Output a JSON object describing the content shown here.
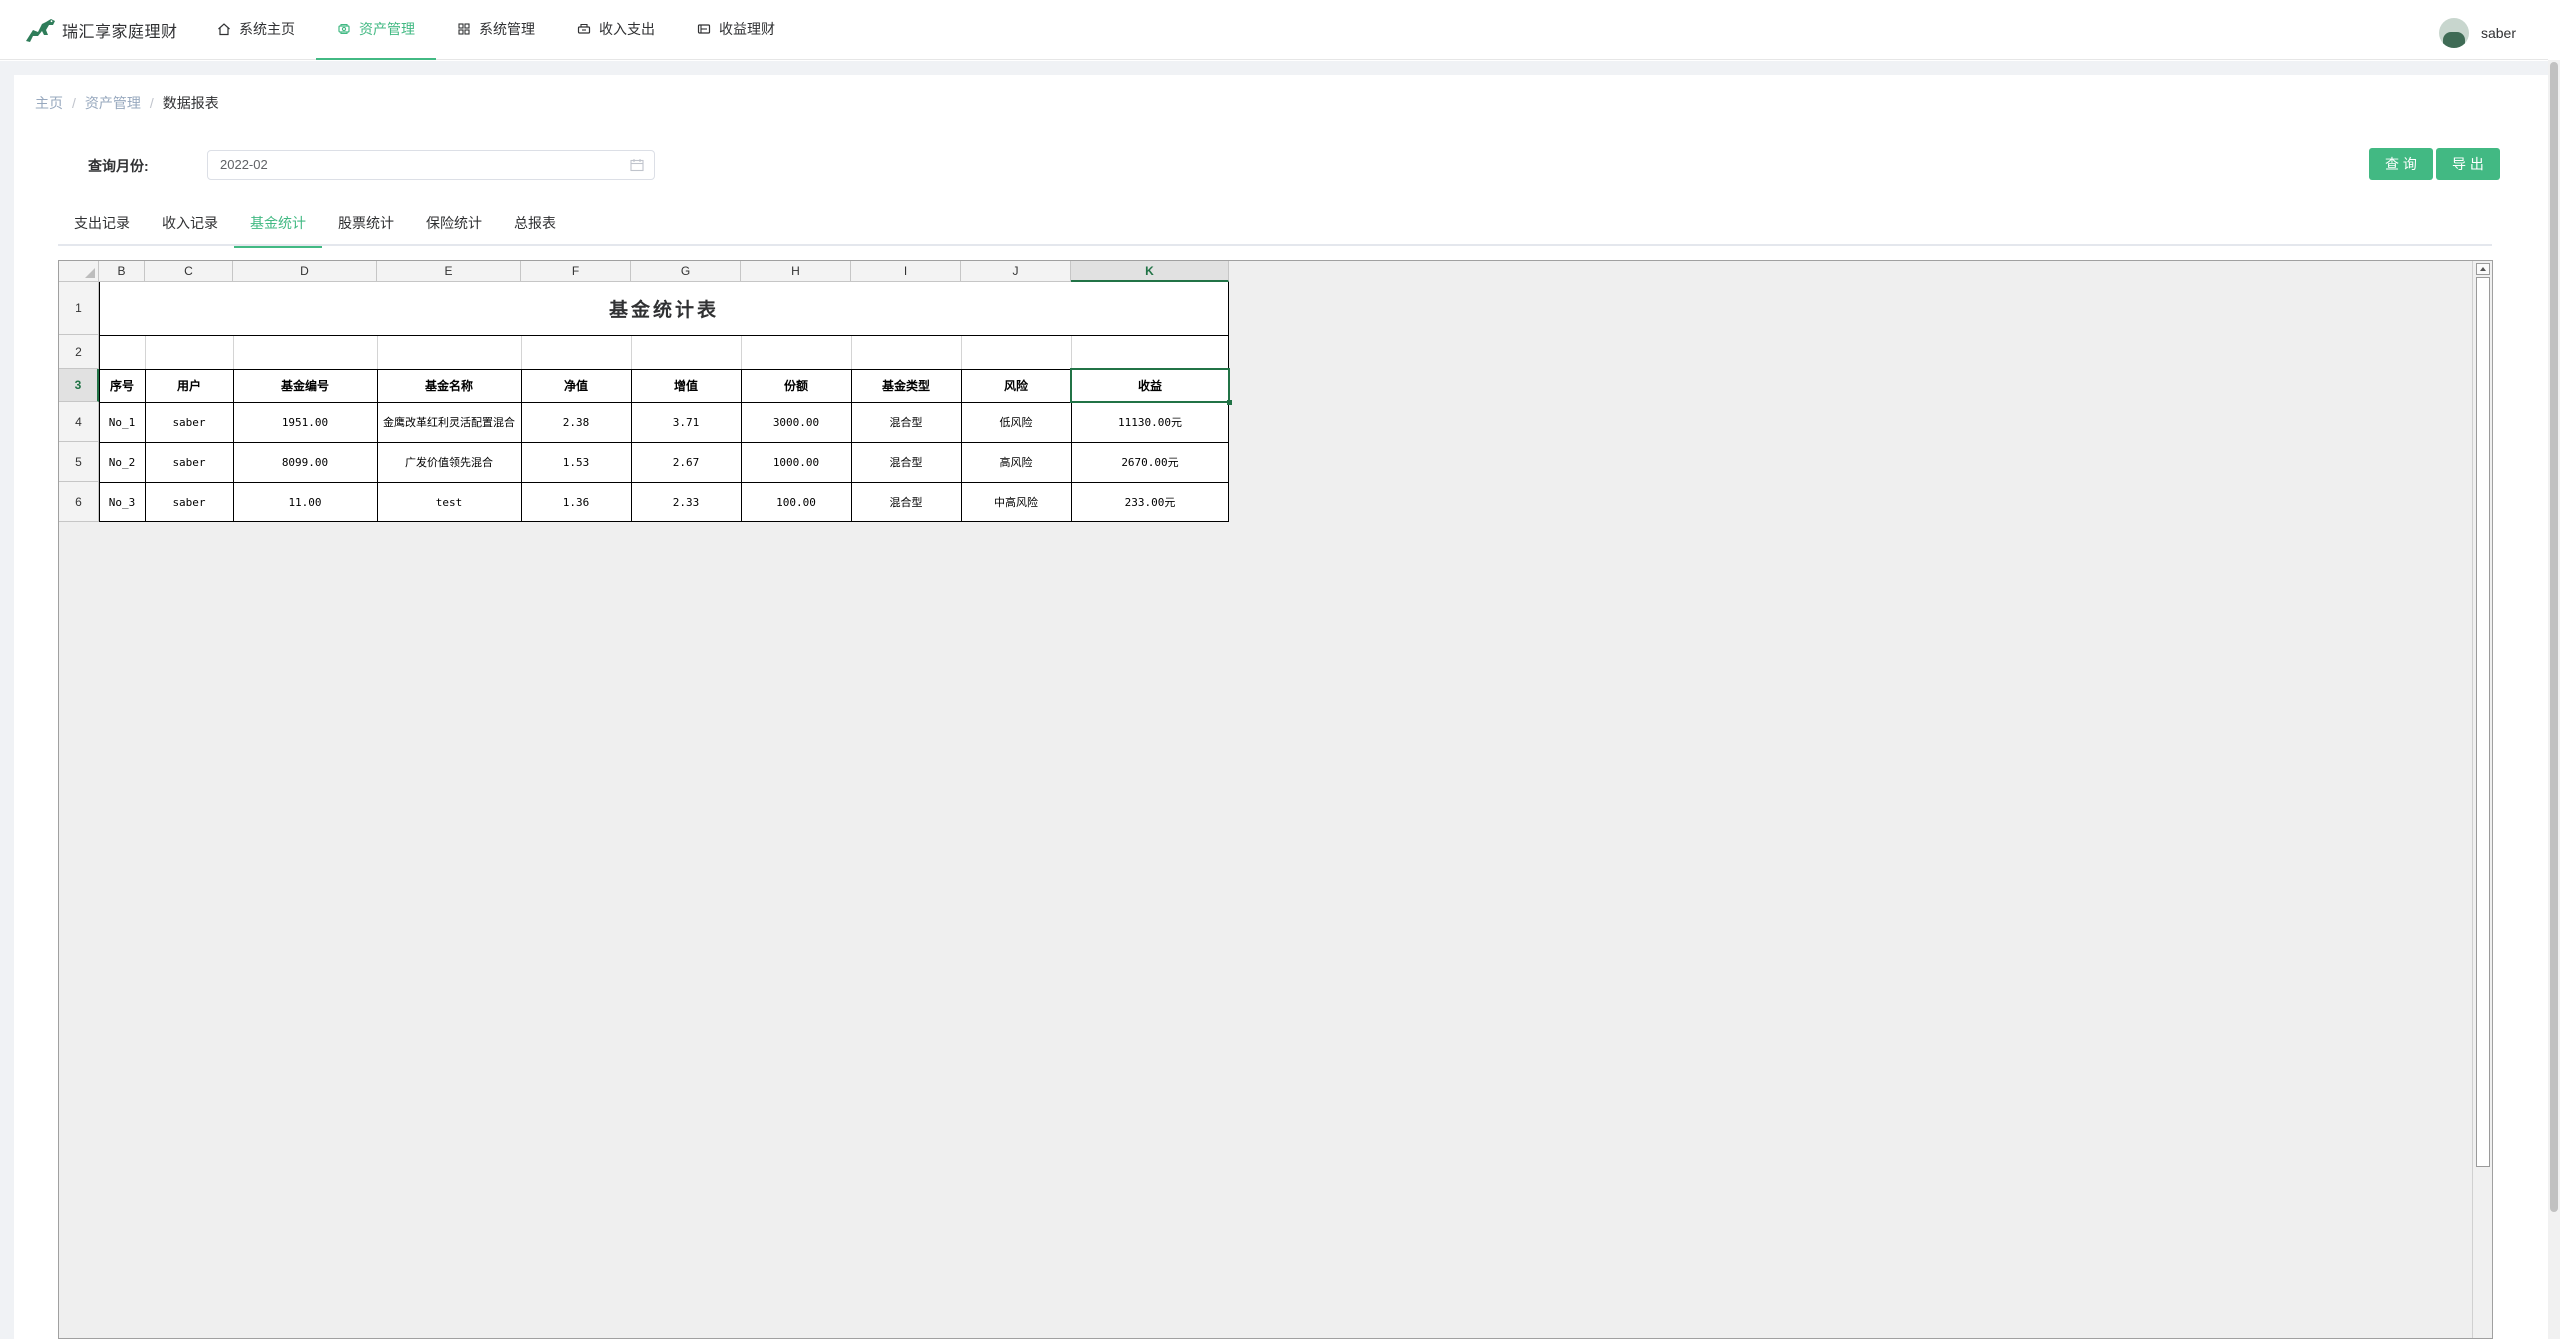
{
  "app": {
    "title": "瑞汇享家庭理财"
  },
  "nav": {
    "items": [
      {
        "label": "系统主页",
        "icon": "home-icon",
        "active": false
      },
      {
        "label": "资产管理",
        "icon": "asset-icon",
        "active": true
      },
      {
        "label": "系统管理",
        "icon": "grid-icon",
        "active": false
      },
      {
        "label": "收入支出",
        "icon": "wallet-icon",
        "active": false
      },
      {
        "label": "收益理财",
        "icon": "finance-icon",
        "active": false
      }
    ]
  },
  "user": {
    "name": "saber"
  },
  "breadcrumb": {
    "items": [
      "主页",
      "资产管理",
      "数据报表"
    ]
  },
  "filter": {
    "label": "查询月份:",
    "month_value": "2022-02"
  },
  "buttons": {
    "query": "查 询",
    "export": "导 出"
  },
  "tabs": [
    {
      "label": "支出记录",
      "active": false
    },
    {
      "label": "收入记录",
      "active": false
    },
    {
      "label": "基金统计",
      "active": true
    },
    {
      "label": "股票统计",
      "active": false
    },
    {
      "label": "保险统计",
      "active": false
    },
    {
      "label": "总报表",
      "active": false
    }
  ],
  "sheet": {
    "columns": [
      "B",
      "C",
      "D",
      "E",
      "F",
      "G",
      "H",
      "I",
      "J",
      "K"
    ],
    "selected_column": "K",
    "rows": [
      "1",
      "2",
      "3",
      "4",
      "5",
      "6"
    ],
    "selected_row": "3",
    "title": "基金统计表",
    "headers": [
      "序号",
      "用户",
      "基金编号",
      "基金名称",
      "净值",
      "增值",
      "份额",
      "基金类型",
      "风险",
      "收益"
    ],
    "data": [
      [
        "No_1",
        "saber",
        "1951.00",
        "金鹰改革红利灵活配置混合",
        "2.38",
        "3.71",
        "3000.00",
        "混合型",
        "低风险",
        "11130.00元"
      ],
      [
        "No_2",
        "saber",
        "8099.00",
        "广发价值领先混合",
        "1.53",
        "2.67",
        "1000.00",
        "混合型",
        "高风险",
        "2670.00元"
      ],
      [
        "No_3",
        "saber",
        "11.00",
        "test",
        "1.36",
        "2.33",
        "100.00",
        "混合型",
        "中高风险",
        "233.00元"
      ]
    ]
  },
  "colors": {
    "accent": "#42b983",
    "excel_green": "#217346"
  }
}
